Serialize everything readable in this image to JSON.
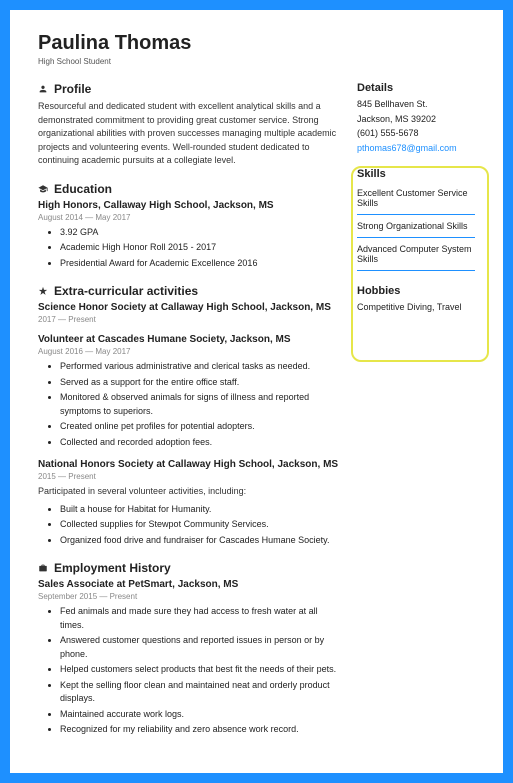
{
  "header": {
    "name": "Paulina Thomas",
    "subtitle": "High School Student"
  },
  "profile": {
    "heading": "Profile",
    "text": "Resourceful and dedicated student with excellent analytical skills and a demonstrated commitment to providing great customer service. Strong organizational abilities with proven successes managing multiple academic projects and volunteering events. Well-rounded student dedicated to continuing academic pursuits at a collegiate level."
  },
  "education": {
    "heading": "Education",
    "entries": [
      {
        "title": "High Honors, Callaway High School, Jackson, MS",
        "dates": "August 2014 — May 2017",
        "bullets": [
          "3.92 GPA",
          "Academic High Honor Roll 2015 - 2017",
          "Presidential Award for Academic Excellence 2016"
        ]
      }
    ]
  },
  "extracurricular": {
    "heading": "Extra-curricular activities",
    "entries": [
      {
        "title": "Science Honor Society at Callaway High School, Jackson, MS",
        "dates": "2017 — Present"
      },
      {
        "title": "Volunteer at Cascades Humane Society, Jackson, MS",
        "dates": "August 2016 — May 2017",
        "bullets": [
          "Performed various administrative and clerical tasks as needed.",
          "Served as a support for the entire office staff.",
          "Monitored & observed animals for signs of illness and reported symptoms to superiors.",
          "Created online pet profiles for potential adopters.",
          "Collected and recorded adoption fees."
        ]
      },
      {
        "title": "National Honors Society at Callaway High School, Jackson, MS",
        "dates": "2015 — Present",
        "intro": "Participated in several volunteer activities, including:",
        "bullets": [
          "Built a house for Habitat for Humanity.",
          "Collected supplies for Stewpot Community Services.",
          "Organized food drive and fundraiser for Cascades Humane Society."
        ]
      }
    ]
  },
  "employment": {
    "heading": "Employment History",
    "entries": [
      {
        "title": "Sales Associate at PetSmart, Jackson, MS",
        "dates": "September 2015 — Present",
        "bullets": [
          "Fed animals and made sure they had access to fresh water at all times.",
          "Answered customer questions and reported issues in person or by phone.",
          "Helped customers select products that best fit the needs of their pets.",
          "Kept the selling floor clean and maintained neat and orderly product displays.",
          "Maintained accurate work logs.",
          "Recognized for my reliability and zero absence work record."
        ]
      }
    ]
  },
  "details": {
    "heading": "Details",
    "address1": "845 Bellhaven St.",
    "address2": "Jackson, MS 39202",
    "phone": "(601) 555-5678",
    "email": "pthomas678@gmail.com"
  },
  "skills": {
    "heading": "Skills",
    "items": [
      "Excellent Customer Service Skills",
      "Strong Organizational Skills",
      "Advanced Computer System Skills"
    ]
  },
  "hobbies": {
    "heading": "Hobbies",
    "text": "Competitive Diving, Travel"
  }
}
